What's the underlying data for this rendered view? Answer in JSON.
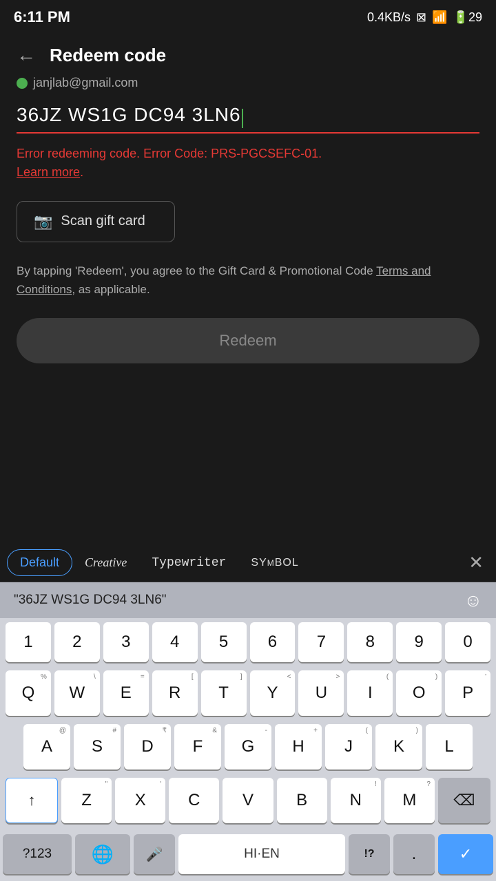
{
  "statusBar": {
    "time": "6:11 PM",
    "network": "0.4KB/s",
    "battery": "29"
  },
  "header": {
    "backLabel": "←",
    "title": "Redeem code"
  },
  "email": {
    "address": "janjlab@gmail.com"
  },
  "codeInput": {
    "value": "36JZ WS1G DC94 3LN6"
  },
  "errorMessage": {
    "text": "Error redeeming code. Error Code: PRS-PGCSEFC-01.",
    "learnMore": "Learn more"
  },
  "scanButton": {
    "label": "Scan gift card"
  },
  "termsText": {
    "prefix": "By tapping 'Redeem', you agree to the Gift Card & Promotional Code ",
    "link": "Terms and Conditions",
    "suffix": ", as applicable."
  },
  "redeemButton": {
    "label": "Redeem"
  },
  "keyboard": {
    "fontTabs": [
      {
        "label": "Default",
        "active": true,
        "style": "default"
      },
      {
        "label": "Creative",
        "active": false,
        "style": "creative"
      },
      {
        "label": "Typewriter",
        "active": false,
        "style": "typewriter"
      },
      {
        "label": "SYM BOL",
        "active": false,
        "style": "symbol"
      }
    ],
    "closeLabel": "✕",
    "autocompleteText": "\"36JZ WS1G DC94 3LN6\"",
    "emojiLabel": "☺",
    "numberRow": [
      "1",
      "2",
      "3",
      "4",
      "5",
      "6",
      "7",
      "8",
      "9",
      "0"
    ],
    "numberSubLabels": [
      "%",
      "\\",
      "=",
      "[",
      "]",
      "<",
      ">",
      "(",
      ")",
      "'"
    ],
    "row1": [
      "Q",
      "W",
      "E",
      "R",
      "T",
      "Y",
      "U",
      "I",
      "O",
      "P"
    ],
    "row1Sub": [
      "%",
      "\\",
      "=",
      "[",
      "]",
      "<",
      ">",
      "(",
      ")",
      "'"
    ],
    "row2": [
      "A",
      "S",
      "D",
      "F",
      "G",
      "H",
      "J",
      "K",
      "L"
    ],
    "row2Sub": [
      "@",
      "#",
      "₹",
      "&",
      "-",
      "+",
      "(",
      ")",
      ")"
    ],
    "row3": [
      "Z",
      "X",
      "C",
      "V",
      "B",
      "N",
      "M"
    ],
    "row3Sub": [
      "\"",
      "'",
      ",",
      ";",
      "!",
      "?"
    ],
    "shiftIcon": "↑",
    "backspaceIcon": "⌫",
    "bottomRow": {
      "numbersLabel": "?123",
      "globeIcon": "🌐",
      "micIcon": "🎤",
      "spaceLabel": "HI·EN",
      "dotLabel": ".",
      "exclLabel": "!?",
      "checkLabel": "✓"
    }
  }
}
